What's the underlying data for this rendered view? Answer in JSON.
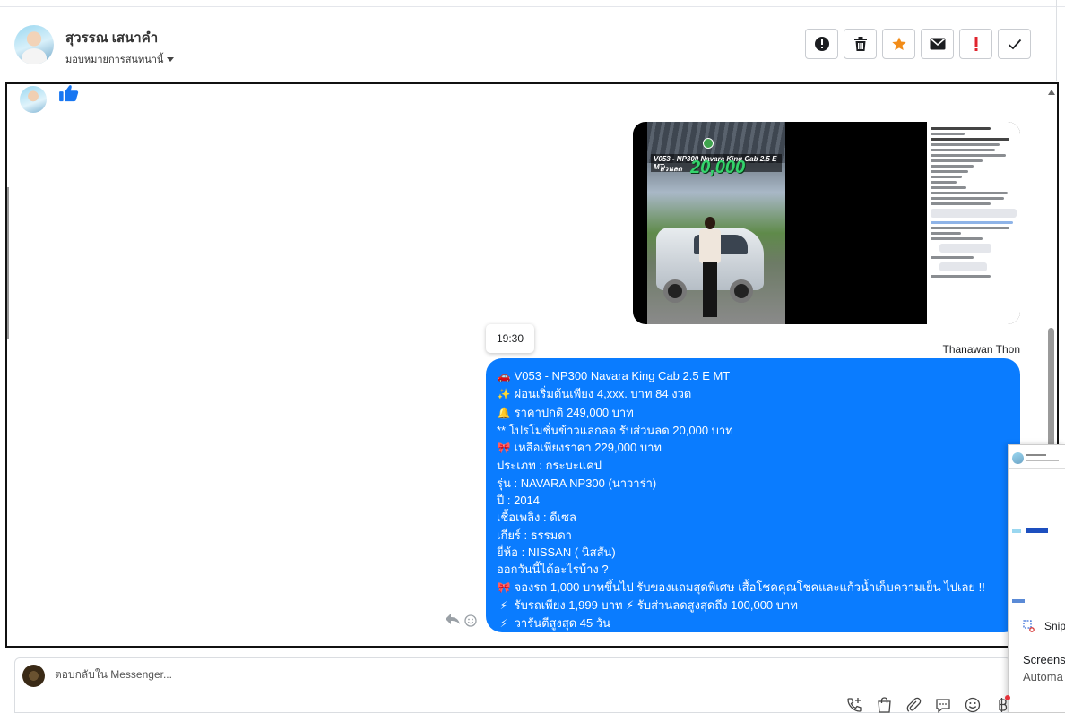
{
  "header": {
    "contact_name": "สุวรรณ เสนาคำ",
    "assign_label": "มอบหมายการสนทนานี้"
  },
  "toolbar": {
    "buttons": [
      {
        "name": "alert",
        "icon": "exclamation-circle-icon"
      },
      {
        "name": "delete",
        "icon": "trash-icon"
      },
      {
        "name": "star",
        "icon": "star-icon",
        "color": "#f28c18"
      },
      {
        "name": "email",
        "icon": "envelope-icon"
      },
      {
        "name": "spam",
        "icon": "exclamation-icon",
        "color": "#e0242e"
      },
      {
        "name": "done",
        "icon": "check-icon"
      }
    ]
  },
  "chat": {
    "incoming_reaction": "thumbs-up-icon",
    "media_preview": {
      "post_title": "V053 - NP300 Navara King Cab 2.5 E MT",
      "discount_label": "ส่วนลด",
      "discount_amount": "20,000"
    },
    "timestamp": "19:30",
    "sender_name": "Thanawan Thon",
    "message_lines": [
      {
        "emoji": "🚗",
        "text": "V053 - NP300 Navara King Cab 2.5 E MT"
      },
      {
        "emoji": "✨",
        "text": "ผ่อนเริ่มต้นเพียง 4,xxx. บาท 84 งวด"
      },
      {
        "emoji": "🔔",
        "text": "ราคาปกติ 249,000 บาท"
      },
      {
        "emoji": "",
        "text": "** โปรโมชั่นข้าวแลกลด รับส่วนลด 20,000 บาท"
      },
      {
        "emoji": "🎀",
        "text": "เหลือเพียงราคา 229,000 บาท"
      },
      {
        "emoji": "",
        "text": "ประเภท : กระบะแคป"
      },
      {
        "emoji": "",
        "text": "รุ่น : NAVARA NP300 (นาวาร่า)"
      },
      {
        "emoji": "",
        "text": "ปี : 2014"
      },
      {
        "emoji": "",
        "text": "เชื้อเพลิง : ดีเซล"
      },
      {
        "emoji": "",
        "text": "เกียร์ : ธรรมดา"
      },
      {
        "emoji": "",
        "text": "ยี่ห้อ : NISSAN ( นิสสัน)"
      },
      {
        "emoji": "",
        "text": "ออกวันนี้ได้อะไรบ้าง ?"
      },
      {
        "emoji": "🎀",
        "text": "จองรถ 1,000 บาทขึ้นไป รับของแถมสุดพิเศษ เสื้อโชคคุณโชคและแก้วน้ำเก็บความเย็น ไปเลย !!"
      },
      {
        "emoji": "⚡",
        "text": "รับรถเพียง 1,999 บาท ⚡ รับส่วนลดสูงสุดถึง 100,000 บาท"
      },
      {
        "emoji": "⚡",
        "text": "วารันตีสูงสุด 45 วัน"
      }
    ],
    "bubble_color": "#0a7cff"
  },
  "composer": {
    "placeholder": "ตอบกลับใน Messenger...",
    "icons": [
      "phone-plus-icon",
      "shopping-bag-icon",
      "paperclip-icon",
      "saved-reply-icon",
      "emoji-icon",
      "baht-icon"
    ]
  },
  "popup": {
    "snip_label": "Snip",
    "screens_label": "Screens",
    "automa_label": "Automa"
  }
}
